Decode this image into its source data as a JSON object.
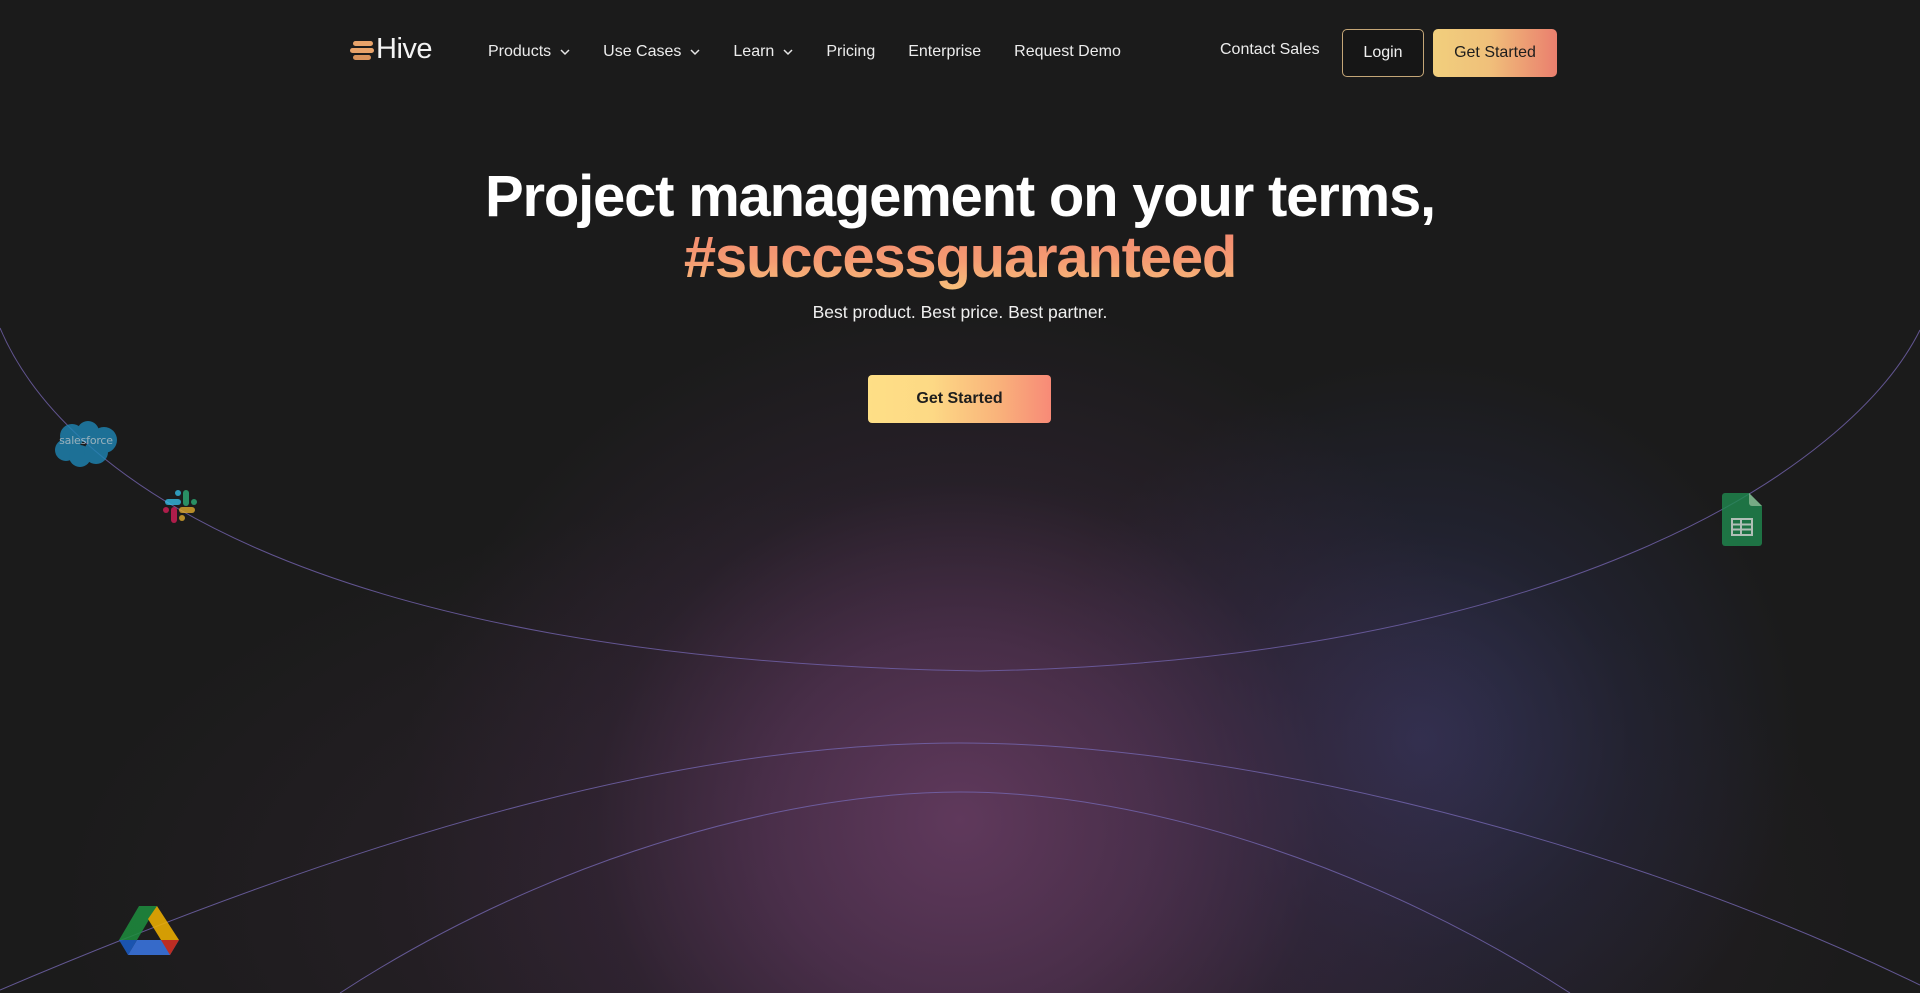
{
  "header": {
    "logo_text": "Hive",
    "nav": [
      {
        "label": "Products",
        "has_dropdown": true
      },
      {
        "label": "Use Cases",
        "has_dropdown": true
      },
      {
        "label": "Learn",
        "has_dropdown": true
      },
      {
        "label": "Pricing",
        "has_dropdown": false
      },
      {
        "label": "Enterprise",
        "has_dropdown": false
      },
      {
        "label": "Request Demo",
        "has_dropdown": false
      }
    ],
    "contact_sales": "Contact Sales",
    "login": "Login",
    "get_started": "Get Started"
  },
  "hero": {
    "title": "Project management on your terms,",
    "accent": "#successguaranteed",
    "subtitle": "Best product. Best price. Best partner.",
    "cta": "Get Started"
  },
  "integrations": [
    {
      "name": "salesforce",
      "label": "salesforce"
    },
    {
      "name": "slack",
      "label": ""
    },
    {
      "name": "google-sheets",
      "label": ""
    },
    {
      "name": "google-drive",
      "label": ""
    }
  ],
  "colors": {
    "background": "#1b1b1b",
    "accent_gradient_start": "#f1cf7d",
    "accent_gradient_end": "#ea7f6e",
    "login_border": "#c4a677",
    "arc_line": "#7a68b0"
  }
}
